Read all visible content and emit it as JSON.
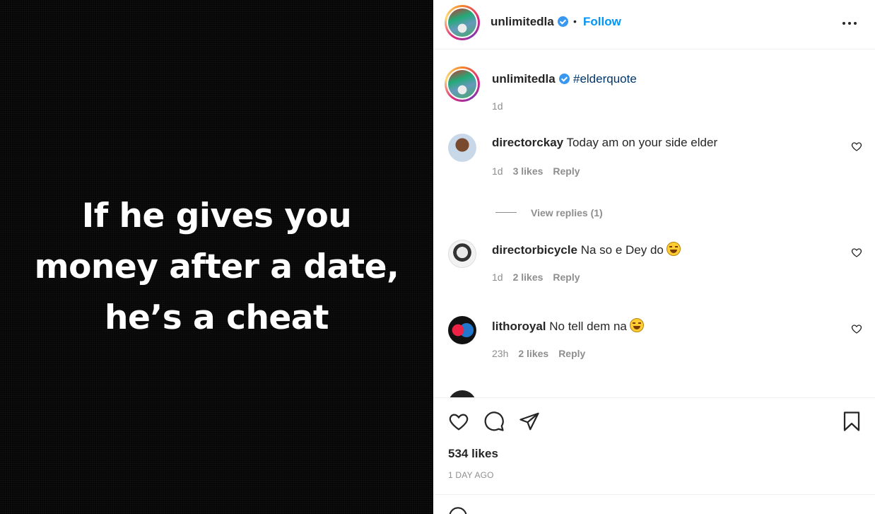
{
  "post": {
    "quote_lines": [
      "If he gives you",
      "money after a date,",
      "he’s a cheat"
    ]
  },
  "header": {
    "username": "unlimitedla",
    "separator": "•",
    "follow_label": "Follow"
  },
  "caption": {
    "username": "unlimitedla",
    "hashtag": "#elderquote",
    "time": "1d"
  },
  "comments": [
    {
      "username": "directorckay",
      "text": "Today am on your side elder",
      "time": "1d",
      "likes": "3 likes",
      "reply": "Reply",
      "view_replies": "View replies (1)"
    },
    {
      "username": "directorbicycle",
      "text": "Na so e Dey do",
      "time": "1d",
      "likes": "2 likes",
      "reply": "Reply"
    },
    {
      "username": "lithoroyal",
      "text": "No tell dem na",
      "time": "23h",
      "likes": "2 likes",
      "reply": "Reply"
    }
  ],
  "footer": {
    "likes": "534 likes",
    "posted": "1 DAY AGO"
  },
  "icons": {
    "more": "more-options-icon",
    "verified": "verified-badge-icon",
    "like": "heart-icon",
    "comment": "comment-icon",
    "share": "paper-plane-icon",
    "save": "bookmark-icon"
  },
  "colors": {
    "link": "#0095f6",
    "hashtag": "#00376b",
    "verified": "#3897f0",
    "muted": "#8e8e8e"
  }
}
